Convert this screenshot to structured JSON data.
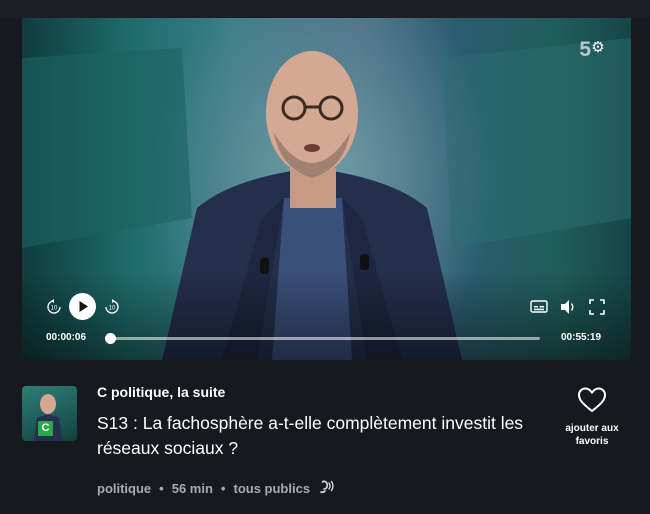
{
  "player": {
    "channel_logo": "5",
    "current_time": "00:00:06",
    "total_time": "00:55:19",
    "progress_fraction": 0.0018,
    "skip_back_label": "10",
    "skip_forward_label": "10",
    "icons": [
      "settings-icon",
      "rewind-10-icon",
      "play-icon",
      "forward-10-icon",
      "subtitles-icon",
      "volume-icon",
      "fullscreen-icon"
    ]
  },
  "program": {
    "thumbnail_badge": "C",
    "show_title": "C politique, la suite",
    "episode_title": "S13 : La fachosphère a-t-elle complètement investit les réseaux sociaux ?",
    "meta": {
      "category": "politique",
      "duration": "56 min",
      "audience": "tous publics",
      "accessibility_icon": "audio-description-icon"
    }
  },
  "favorite": {
    "label": "ajouter aux favoris",
    "icon": "heart-icon"
  },
  "colors": {
    "page_background": "#16191e",
    "meta_text": "#a7acb3",
    "badge_green": "#2ba748"
  }
}
